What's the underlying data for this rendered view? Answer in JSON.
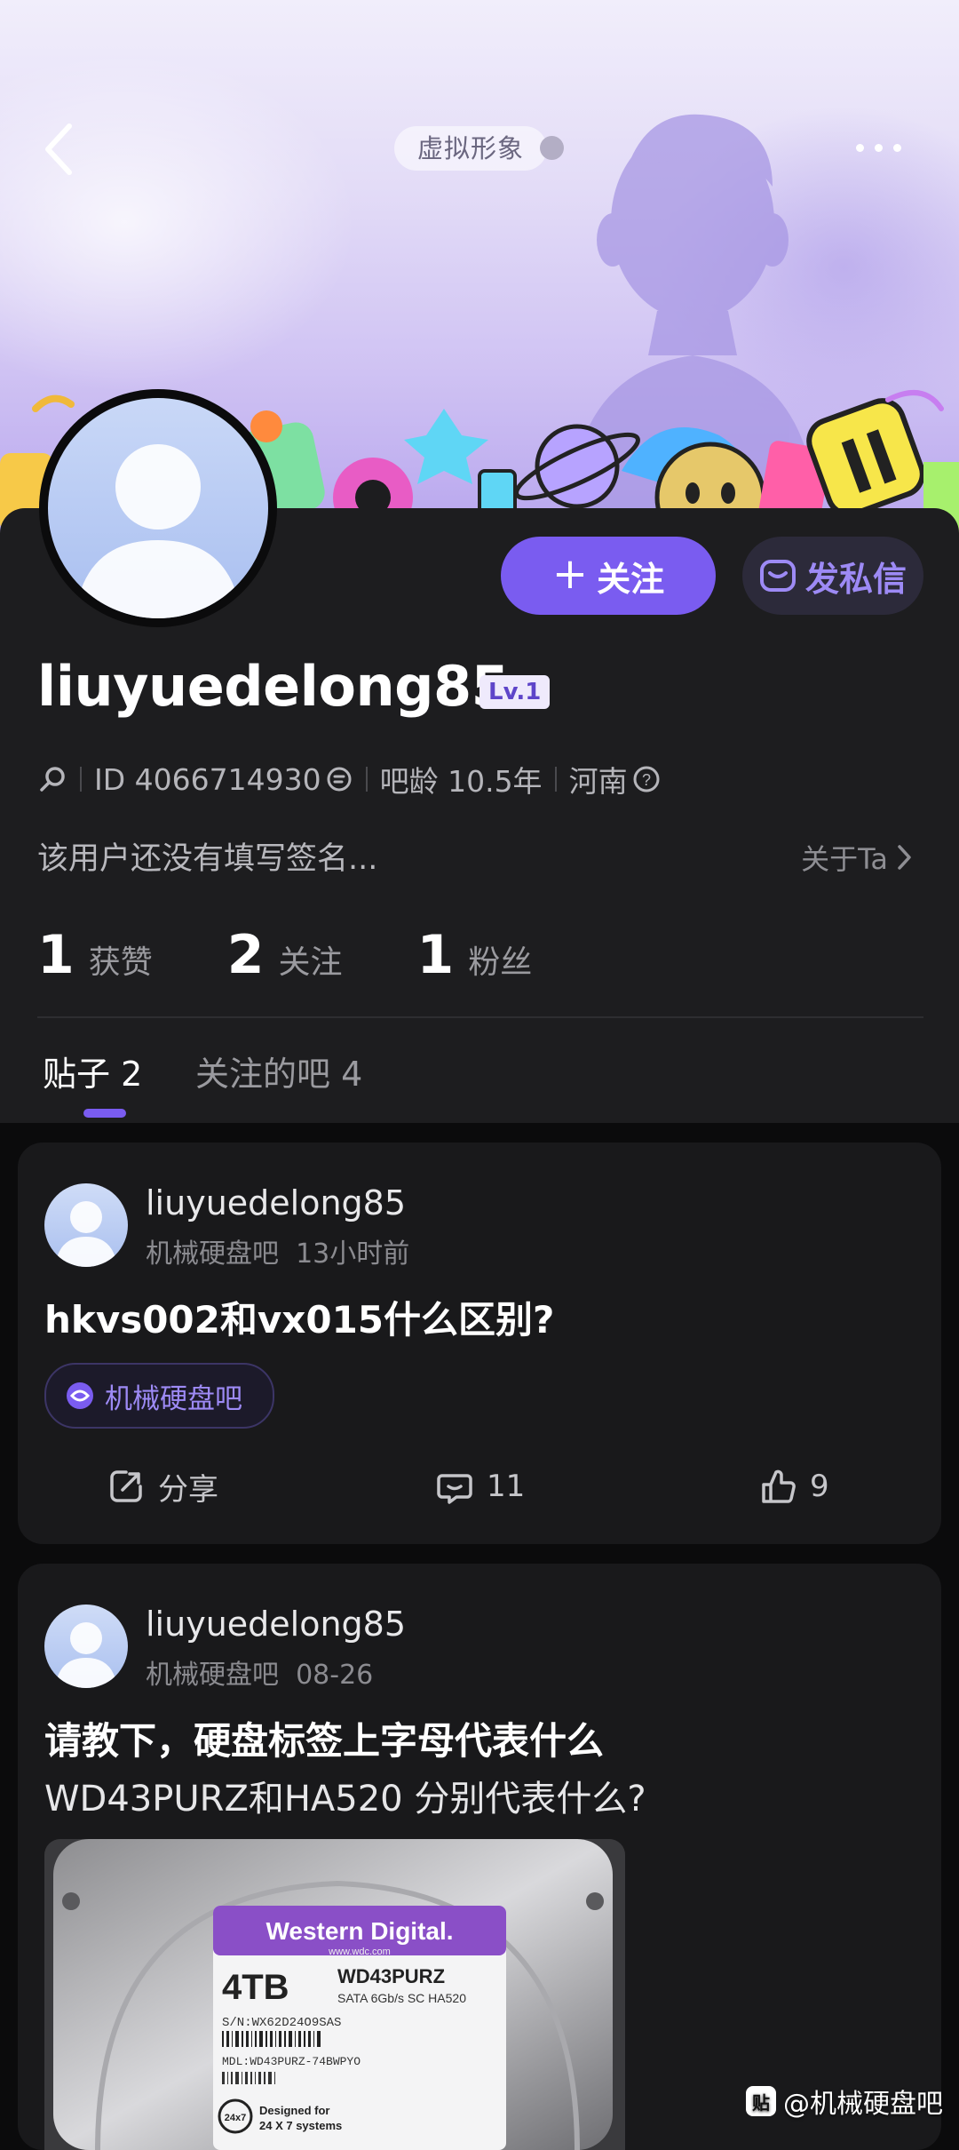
{
  "header": {
    "avatar_pill": "虚拟形象",
    "colors": {
      "banner_top": "#f1eefb",
      "banner_bottom": "#b8a6ee"
    }
  },
  "profile": {
    "username": "liuyuedelong85",
    "level": "Lv.1",
    "id_text": "ID 4066714930",
    "tieba_age": "吧龄 10.5年",
    "location": "河南",
    "bio": "该用户还没有填写签名...",
    "about": "关于Ta",
    "follow_label": "关注",
    "message_label": "发私信",
    "stats": [
      {
        "num": "1",
        "label": "获赞"
      },
      {
        "num": "2",
        "label": "关注"
      },
      {
        "num": "1",
        "label": "粉丝"
      }
    ],
    "tabs": [
      {
        "label": "贴子 2",
        "active": true
      },
      {
        "label": "关注的吧 4",
        "active": false
      }
    ],
    "accent_color": "#7a5cf0"
  },
  "posts": [
    {
      "author": "liuyuedelong85",
      "forum": "机械硬盘吧",
      "time": "13小时前",
      "title": "hkvs002和vx015什么区别?",
      "forum_chip": "机械硬盘吧",
      "share_label": "分享",
      "comments": "11",
      "likes": "9"
    },
    {
      "author": "liuyuedelong85",
      "forum": "机械硬盘吧",
      "time": "08-26",
      "title": "请教下，硬盘标签上字母代表什么",
      "body": "WD43PURZ和HA520 分别代表什么?",
      "photo": {
        "brand": "Western Digital.",
        "site": "www.wdc.com",
        "capacity": "4TB",
        "model": "WD43PURZ",
        "spec": "SATA 6Gb/s  SC HA520",
        "serial": "S/N:WX62D24O9SAS",
        "mdl": "MDL:WD43PURZ-74BWPYO",
        "badge": "24x7",
        "designed": "Designed for",
        "designed2": "24 X 7 systems"
      }
    }
  ],
  "watermark": {
    "icon": "贴",
    "text": "@机械硬盘吧"
  }
}
